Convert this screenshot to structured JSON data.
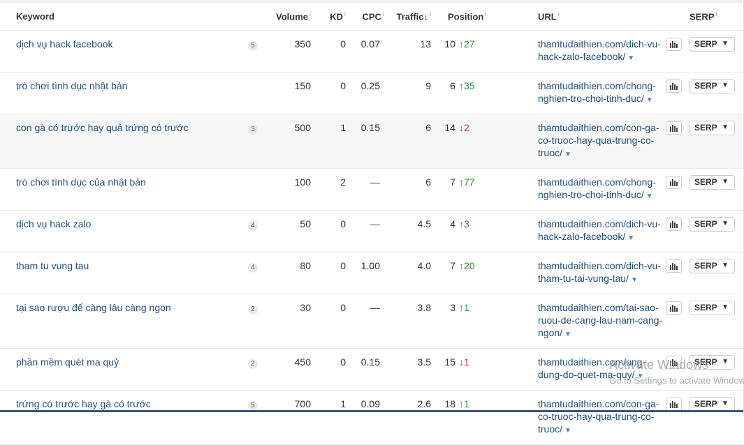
{
  "headers": {
    "keyword": "Keyword",
    "volume": "Volume",
    "kd": "KD",
    "cpc": "CPC",
    "traffic": "Traffic",
    "traffic_sort": "↓",
    "position": "Position",
    "url": "URL",
    "serp": "SERP",
    "info_mark": "i"
  },
  "rows": [
    {
      "keyword": "dịch vụ hack facebook",
      "badge": "5",
      "volume": "350",
      "kd": "0",
      "cpc": "0.07",
      "traffic": "13",
      "position": "10",
      "change_dir": "↑",
      "change": "27",
      "url_lines": [
        "thamtudaithien.com/dich-vu-",
        "hack-zalo-facebook/"
      ],
      "serp": "SERP"
    },
    {
      "keyword": "trò chơi tình dục nhật bản",
      "badge": "",
      "volume": "150",
      "kd": "0",
      "cpc": "0.25",
      "traffic": "9",
      "position": "6",
      "change_dir": "↑",
      "change": "35",
      "url_lines": [
        "thamtudaithien.com/chong-",
        "nghien-tro-choi-tinh-duc/"
      ],
      "serp": "SERP"
    },
    {
      "keyword": "con gà có trước hay quả trứng có trước",
      "badge": "3",
      "volume": "500",
      "kd": "1",
      "cpc": "0.15",
      "traffic": "6",
      "position": "14",
      "change_dir": "↓",
      "change": "2",
      "url_lines": [
        "thamtudaithien.com/con-ga-",
        "co-truoc-hay-qua-trung-co-",
        "truoc/"
      ],
      "serp": "SERP"
    },
    {
      "keyword": "trò chơi tình dục của nhật bản",
      "badge": "",
      "volume": "100",
      "kd": "2",
      "cpc": "—",
      "traffic": "6",
      "position": "7",
      "change_dir": "↑",
      "change": "77",
      "url_lines": [
        "thamtudaithien.com/chong-",
        "nghien-tro-choi-tinh-duc/"
      ],
      "serp": "SERP"
    },
    {
      "keyword": "dịch vụ hack zalo",
      "badge": "4",
      "volume": "50",
      "kd": "0",
      "cpc": "—",
      "traffic": "4.5",
      "position": "4",
      "change_dir": "↑",
      "change": "3",
      "url_lines": [
        "thamtudaithien.com/dich-vu-",
        "hack-zalo-facebook/"
      ],
      "serp": "SERP"
    },
    {
      "keyword": "tham tu vung tau",
      "badge": "4",
      "volume": "80",
      "kd": "0",
      "cpc": "1.00",
      "traffic": "4.0",
      "position": "7",
      "change_dir": "↑",
      "change": "20",
      "url_lines": [
        "thamtudaithien.com/dich-vu-",
        "tham-tu-tai-vung-tau/"
      ],
      "serp": "SERP"
    },
    {
      "keyword": "tại sao rượu để càng lâu càng ngon",
      "badge": "2",
      "volume": "30",
      "kd": "0",
      "cpc": "—",
      "traffic": "3.8",
      "position": "3",
      "change_dir": "↑",
      "change": "1",
      "url_lines": [
        "thamtudaithien.com/tai-sao-",
        "ruou-de-cang-lau-nam-cang-",
        "ngon/"
      ],
      "serp": "SERP"
    },
    {
      "keyword": "phần mềm quét ma quỷ",
      "badge": "2",
      "volume": "450",
      "kd": "0",
      "cpc": "0.15",
      "traffic": "3.5",
      "position": "15",
      "change_dir": "↓",
      "change": "1",
      "url_lines": [
        "thamtudaithien.com/ung-",
        "dung-do-quet-ma-quy/"
      ],
      "serp": "SERP"
    },
    {
      "keyword": "trứng có trước hay gà có trước",
      "badge": "5",
      "volume": "700",
      "kd": "1",
      "cpc": "0.09",
      "traffic": "2.6",
      "position": "18",
      "change_dir": "↑",
      "change": "1",
      "url_lines": [
        "thamtudaithien.com/con-ga-",
        "co-truoc-hay-qua-trung-co-",
        "truoc/"
      ],
      "serp": "SERP"
    }
  ],
  "url_caret": "▼",
  "serp_caret": "▼",
  "watermark": {
    "title": "Activate Windows",
    "subtitle": "Go to Settings to activate Windows."
  },
  "colors": {
    "link": "#1f4d85",
    "up": "#2e8b3a",
    "down": "#c0392b",
    "row_alt": "#f7f7f7",
    "bottom_bar": "#3b5378"
  },
  "icons": {
    "chart": "bar-chart-icon",
    "dropdown": "chevron-down-icon",
    "sort": "sort-desc-icon"
  }
}
